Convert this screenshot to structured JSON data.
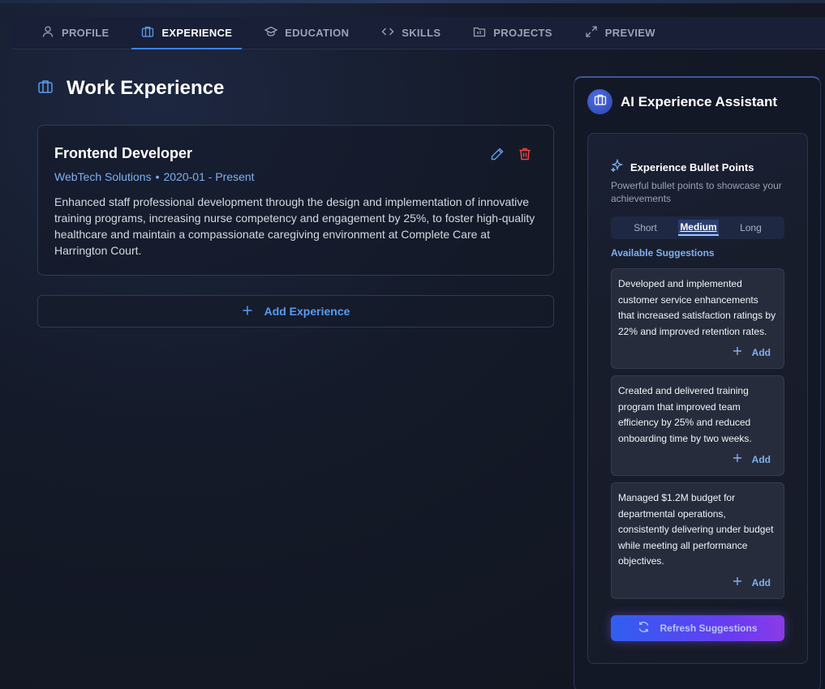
{
  "nav": {
    "tabs": [
      {
        "label": "PROFILE",
        "icon": "user-icon"
      },
      {
        "label": "EXPERIENCE",
        "icon": "briefcase-icon",
        "active": true
      },
      {
        "label": "EDUCATION",
        "icon": "graduation-cap-icon"
      },
      {
        "label": "SKILLS",
        "icon": "code-icon"
      },
      {
        "label": "PROJECTS",
        "icon": "folder-icon"
      },
      {
        "label": "PREVIEW",
        "icon": "expand-icon"
      }
    ]
  },
  "main": {
    "title": "Work Experience",
    "experiences": [
      {
        "title": "Frontend Developer",
        "company": "WebTech Solutions",
        "separator": "•",
        "dates": "2020-01 - Present",
        "description": "Enhanced staff professional development through the design and implementation of innovative training programs, increasing nurse competency and engagement by 25%, to foster high-quality healthcare and maintain a compassionate caregiving environment at Complete Care at Harrington Court."
      }
    ],
    "add_button_label": "Add Experience"
  },
  "assistant": {
    "title": "AI Experience Assistant",
    "section_title": "Experience Bullet Points",
    "section_desc": "Powerful bullet points to showcase your achievements",
    "length_options": [
      "Short",
      "Medium",
      "Long"
    ],
    "selected_length": "Medium",
    "suggestions_label": "Available Suggestions",
    "add_label": "Add",
    "suggestions": [
      "Developed and implemented customer service enhancements that increased satisfaction ratings by 22% and improved retention rates.",
      "Created and delivered training program that improved team efficiency by 25% and reduced onboarding time by two weeks.",
      "Managed $1.2M budget for departmental operations, consistently delivering under budget while meeting all performance objectives."
    ],
    "refresh_label": "Refresh Suggestions"
  },
  "colors": {
    "accent": "#3b82f6",
    "link": "#7fb0f0",
    "delete": "#ef4444",
    "panel_bg": "#131827"
  }
}
